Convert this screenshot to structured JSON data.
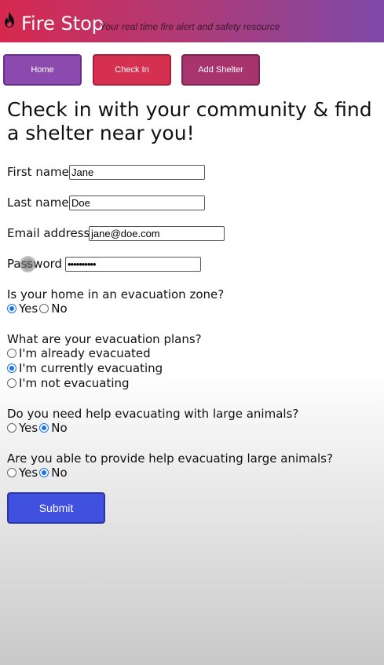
{
  "header": {
    "title": "Fire Stop",
    "tagline": "Your real time fire alert and safety resource",
    "logo_icon": "flame-icon"
  },
  "nav": {
    "home": "Home",
    "check_in": "Check In",
    "add_shelter": "Add Shelter"
  },
  "page": {
    "heading": "Check in with your community & find a shelter near you!"
  },
  "form": {
    "first_name": {
      "label": "First name",
      "value": "Jane"
    },
    "last_name": {
      "label": "Last name",
      "value": "Doe"
    },
    "email": {
      "label": "Email address",
      "value": "jane@doe.com"
    },
    "password": {
      "label": "Password",
      "value": "••••••••••"
    },
    "evac_zone": {
      "question": "Is your home in an evacuation zone?",
      "options": [
        {
          "label": "Yes",
          "checked": true
        },
        {
          "label": "No",
          "checked": false
        }
      ]
    },
    "evac_plans": {
      "question": "What are your evacuation plans?",
      "options": [
        {
          "label": "I'm already evacuated",
          "checked": false
        },
        {
          "label": "I'm currently evacuating",
          "checked": true
        },
        {
          "label": "I'm not evacuating",
          "checked": false
        }
      ]
    },
    "need_help_animals": {
      "question": "Do you need help evacuating with large animals?",
      "options": [
        {
          "label": "Yes",
          "checked": false
        },
        {
          "label": "No",
          "checked": true
        }
      ]
    },
    "provide_help_animals": {
      "question": "Are you able to provide help evacuating large animals?",
      "options": [
        {
          "label": "Yes",
          "checked": false
        },
        {
          "label": "No",
          "checked": true
        }
      ]
    },
    "submit": "Submit"
  },
  "colors": {
    "header_start": "#d6284e",
    "header_end": "#7e49a8",
    "submit": "#4050df",
    "radio_checked": "#1a73e8"
  }
}
